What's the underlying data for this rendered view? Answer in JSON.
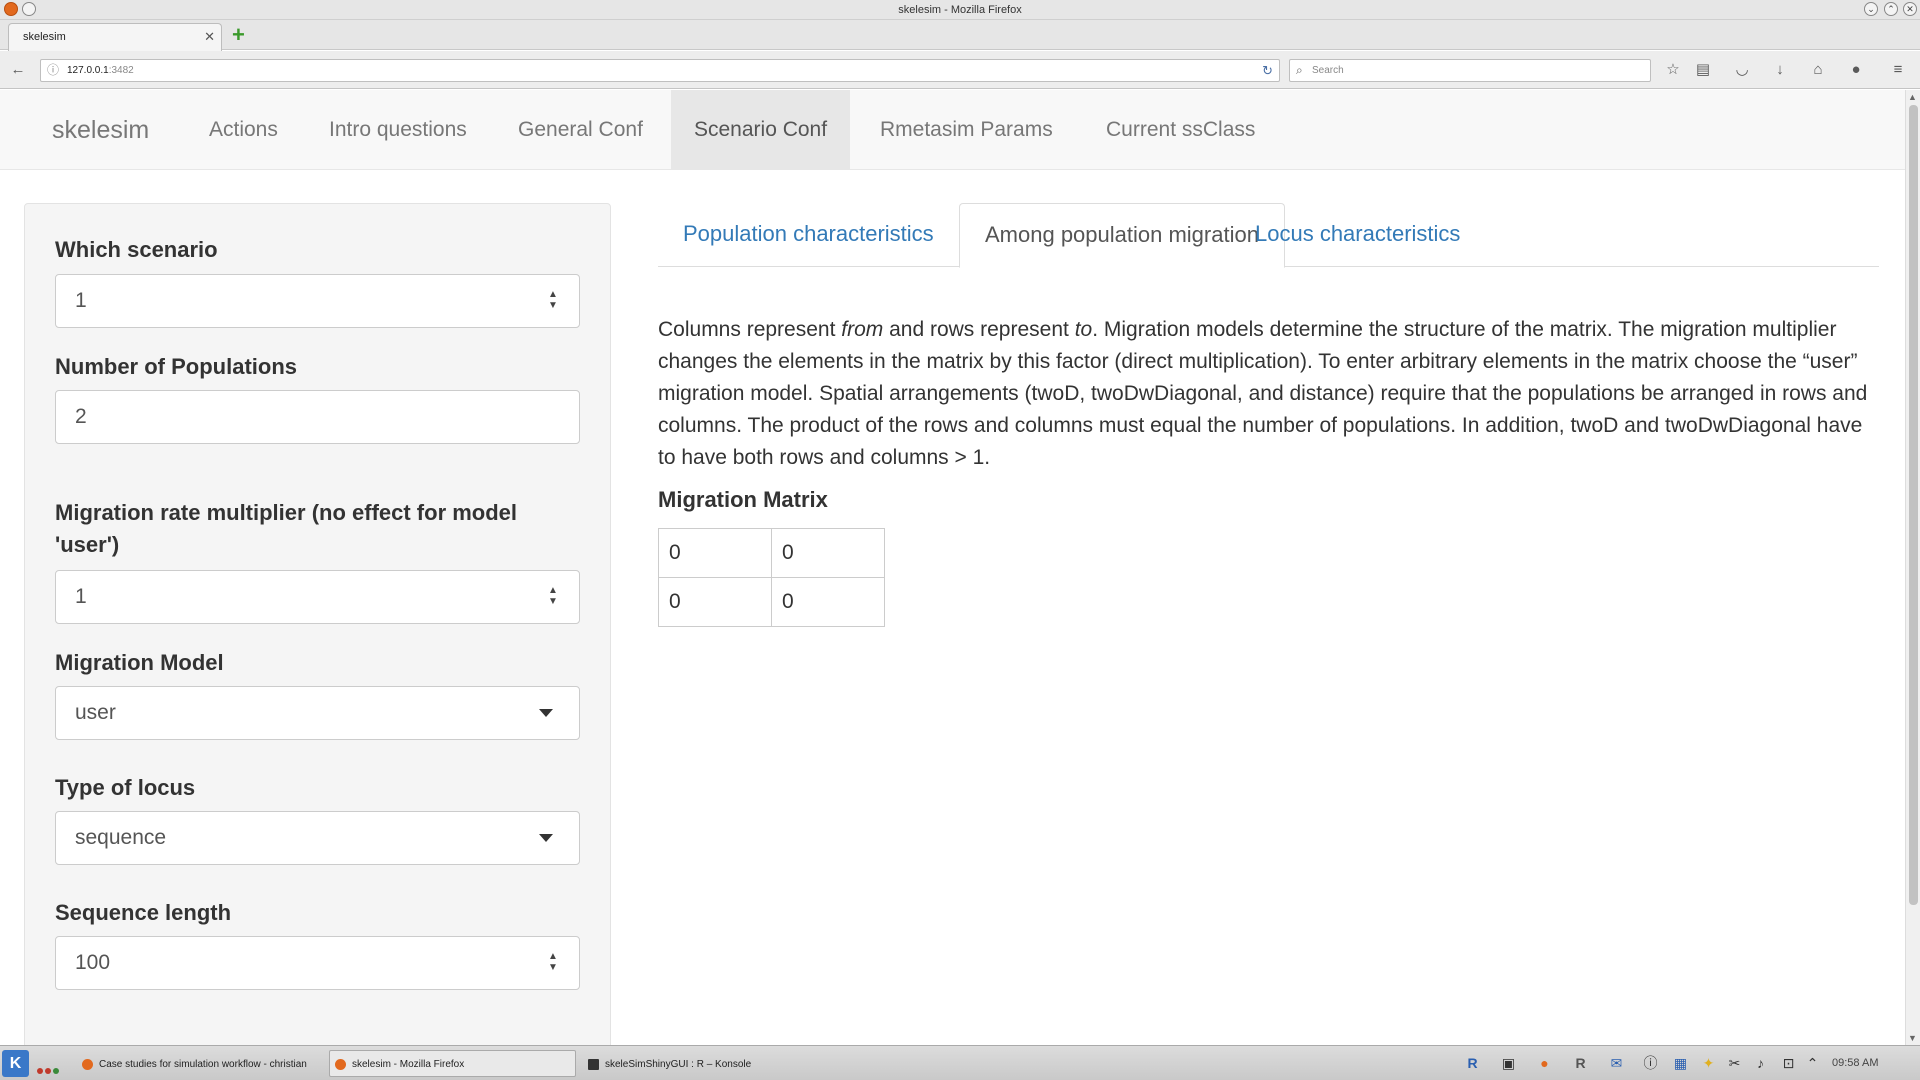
{
  "window": {
    "title": "skelesim - Mozilla Firefox"
  },
  "browser": {
    "tab_label": "skelesim",
    "url_host": "127.0.0.1",
    "url_port": ":3482",
    "search_placeholder": "Search"
  },
  "app": {
    "brand": "skelesim",
    "nav": [
      "Actions",
      "Intro questions",
      "General Conf",
      "Scenario Conf",
      "Rmetasim Params",
      "Current ssClass"
    ],
    "active_nav": "Scenario Conf"
  },
  "sidebar": {
    "which_scenario": {
      "label": "Which scenario",
      "value": "1"
    },
    "num_pops": {
      "label": "Number of Populations",
      "value": "2"
    },
    "mig_mult": {
      "label": "Migration rate multiplier (no effect for model 'user')",
      "value": "1"
    },
    "mig_model": {
      "label": "Migration Model",
      "value": "user"
    },
    "locus_type": {
      "label": "Type of locus",
      "value": "sequence"
    },
    "seq_len": {
      "label": "Sequence length",
      "value": "100"
    }
  },
  "main": {
    "tabs": [
      "Population characteristics",
      "Among population migration",
      "Locus characteristics"
    ],
    "active_tab": "Among population migration",
    "desc": {
      "p1": "Columns represent ",
      "from": "from",
      "p2": " and rows represent ",
      "to": "to",
      "p3": ". Migration models determine the structure of the matrix. The migration multiplier changes the elements in the matrix by this factor (direct multiplication). To enter arbitrary elements in the matrix choose the “user” migration model. Spatial arrangements (twoD, twoDwDiagonal, and distance) require that the populations be arranged in rows and columns. The product of the rows and columns must equal the number of populations. In addition, twoD and twoDwDiagonal have to have both rows and columns > 1."
    },
    "matrix_title": "Migration Matrix",
    "matrix": [
      [
        "0",
        "0"
      ],
      [
        "0",
        "0"
      ]
    ]
  },
  "taskbar": {
    "tasks": [
      "Case studies for simulation workflow - christian",
      "skelesim - Mozilla Firefox",
      "skeleSimShinyGUI : R – Konsole"
    ],
    "clock": "09:58 AM"
  }
}
